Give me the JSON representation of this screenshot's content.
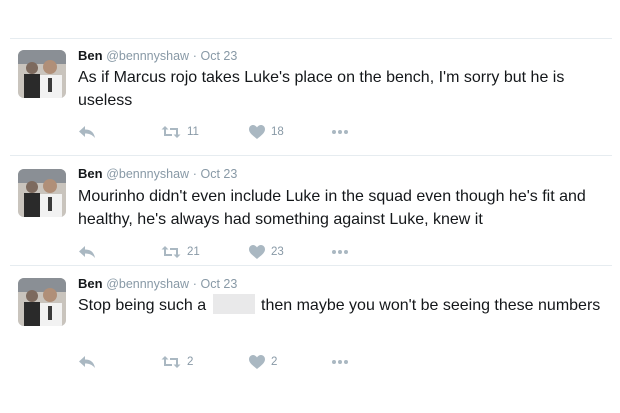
{
  "tweets": [
    {
      "name": "Ben",
      "handle": "@bennnyshaw",
      "separator": "·",
      "date": "Oct 23",
      "text": "As if Marcus rojo takes Luke's place on the bench, I'm sorry but he is useless",
      "retweets": "11",
      "likes": "18"
    },
    {
      "name": "Ben",
      "handle": "@bennnyshaw",
      "separator": "·",
      "date": "Oct 23",
      "text": "Mourinho didn't even include Luke in the squad even though he's fit and healthy, he's always had something against Luke, knew it",
      "retweets": "21",
      "likes": "23"
    },
    {
      "name": "Ben",
      "handle": "@bennnyshaw",
      "separator": "·",
      "date": "Oct 23",
      "text_before": "Stop being such a",
      "text_after": "then maybe you won't be seeing these numbers",
      "retweets": "2",
      "likes": "2"
    }
  ],
  "icons": {
    "reply": "reply-icon",
    "retweet": "retweet-icon",
    "like": "heart-icon",
    "more": "more-icon"
  },
  "colors": {
    "icon": "#aab8c2",
    "text": "#14171a",
    "meta": "#8899a6"
  }
}
